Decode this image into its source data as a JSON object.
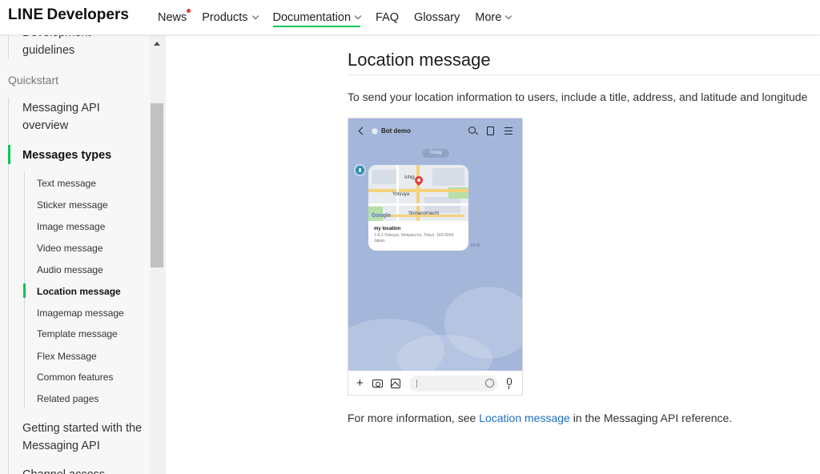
{
  "header": {
    "logo_line": "LINE",
    "logo_dev": "Developers",
    "nav": [
      {
        "label": "News",
        "has_dot": true
      },
      {
        "label": "Products",
        "has_chevron": true
      },
      {
        "label": "Documentation",
        "has_chevron": true,
        "active": true
      },
      {
        "label": "FAQ"
      },
      {
        "label": "Glossary"
      },
      {
        "label": "More",
        "has_chevron": true
      }
    ]
  },
  "sidebar": {
    "top_item": "Development guidelines",
    "section_quickstart": "Quickstart",
    "item_messaging_overview": "Messaging API overview",
    "item_messages_types": "Messages types",
    "sub_items": [
      "Text message",
      "Sticker message",
      "Image message",
      "Video message",
      "Audio message",
      "Location message",
      "Imagemap message",
      "Template message",
      "Flex Message",
      "Common features",
      "Related pages"
    ],
    "active_sub": "Location message",
    "item_getting_started": "Getting started with the Messaging API",
    "item_channel_access": "Channel access"
  },
  "main": {
    "title": "Location message",
    "intro": "To send your location information to users, include a title, address, and latitude and longitude",
    "outro_prefix": "For more information, see ",
    "outro_link": "Location message",
    "outro_suffix": " in the Messaging API reference."
  },
  "phone": {
    "bot_name": "Bot demo",
    "today_label": "Today",
    "map_labels": [
      "Ichig",
      "Yotsuya",
      "Google",
      "Shinanomachi"
    ],
    "location_title": "my location",
    "location_address": "1-6-1 Yotsuya, Shinjuku-ku, Tokyo, 160-0004, Japan",
    "message_time": "14:20"
  },
  "colors": {
    "accent": "#06c755",
    "link": "#1f6fbf",
    "chat_bg": "#a4b7db",
    "news_dot": "#e53935"
  }
}
